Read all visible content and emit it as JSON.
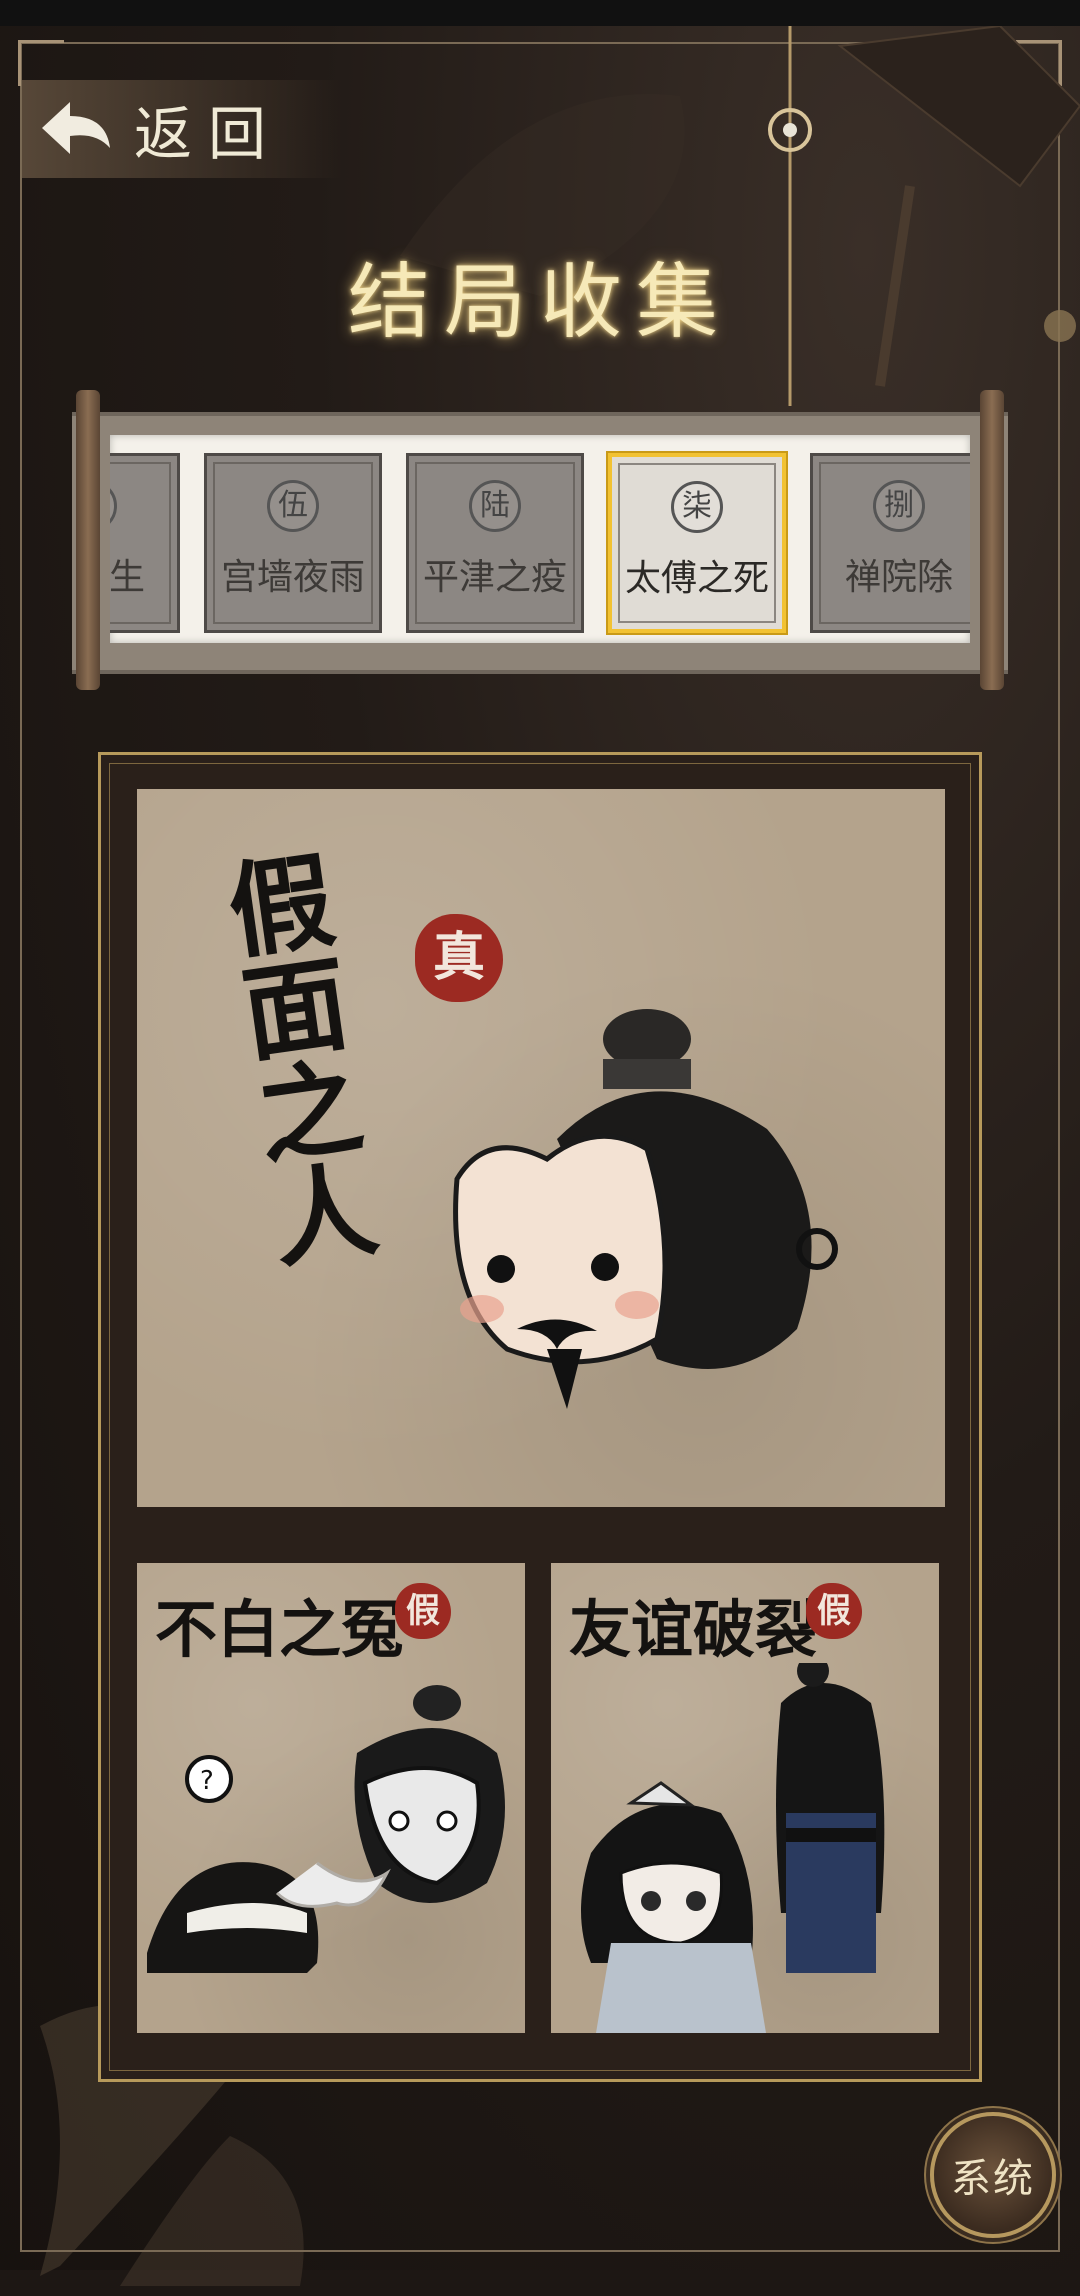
{
  "header": {
    "back_label": "返回",
    "title": "结局收集"
  },
  "chapters": [
    {
      "num": "肆",
      "title": "莲托生",
      "selected": false
    },
    {
      "num": "伍",
      "title": "宫墙夜雨",
      "selected": false
    },
    {
      "num": "陆",
      "title": "平津之疫",
      "selected": false
    },
    {
      "num": "柒",
      "title": "太傅之死",
      "selected": true
    },
    {
      "num": "捌",
      "title": "禅院除",
      "selected": false
    }
  ],
  "endings": {
    "main": {
      "title": "假面之人",
      "seal": "真",
      "seal_meaning": "true"
    },
    "alt1": {
      "title": "不白之冤",
      "seal": "假",
      "seal_meaning": "false"
    },
    "alt2": {
      "title": "友谊破裂",
      "seal": "假",
      "seal_meaning": "false"
    }
  },
  "system_button": {
    "label": "系统"
  },
  "colors": {
    "accent_gold": "#f2c232",
    "seal_red": "#9c2a22",
    "paper": "#b4a38c",
    "title_glow": "#f6e9b8"
  }
}
